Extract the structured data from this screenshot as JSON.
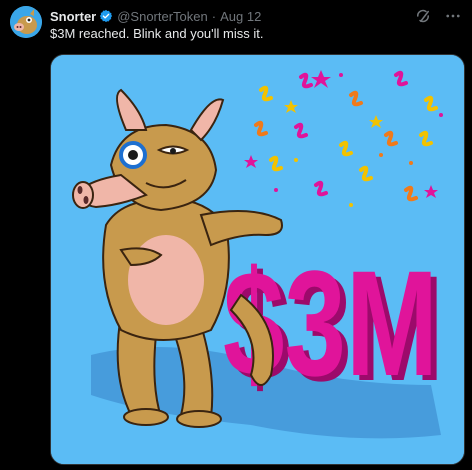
{
  "tweet": {
    "author_name": "Snorter",
    "author_handle": "@SnorterToken",
    "separator": "·",
    "date": "Aug 12",
    "text": "$3M reached. Blink and you'll miss it."
  },
  "media": {
    "big_text": "$3M",
    "background_color": "#5bbcf5",
    "text_color": "#e0149a"
  },
  "icons": {
    "verified": "verified-badge-icon",
    "grok": "grok-icon",
    "more": "more-icon"
  }
}
